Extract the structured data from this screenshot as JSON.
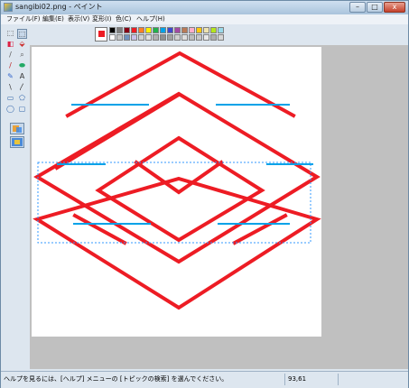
{
  "window": {
    "title": "sangibi02.png - ペイント",
    "minimize": "–",
    "maximize": "□",
    "close": "x"
  },
  "menu": [
    "ファイル(F)",
    "編集(E)",
    "表示(V)",
    "変形(I)",
    "色(C)",
    "ヘルプ(H)"
  ],
  "tools": {
    "free_select": "⬚",
    "rect_select": "⬚",
    "eraser": "◧",
    "fill": "⬙",
    "picker": "/",
    "magnifier": "⌕",
    "pencil": "/",
    "brush": "⬬",
    "airbrush": "✎",
    "text": "A",
    "line": "\\",
    "curve": "〳",
    "rectangle": "▭",
    "polygon": "⬠",
    "ellipse": "◯",
    "rounded_rect": "▢"
  },
  "colors": {
    "foreground": "#ed1c24",
    "background": "#ffffff",
    "palette_row1": [
      "#000000",
      "#7f7f7f",
      "#880015",
      "#ed1c24",
      "#ff7f27",
      "#fff200",
      "#22b14c",
      "#00a2e8",
      "#3f48cc",
      "#a349a4",
      "#b97a57",
      "#ffaec9",
      "#ffc90e",
      "#efe4b0",
      "#b5e61d",
      "#99d9ea"
    ],
    "palette_row2": [
      "#ffffff",
      "#c3c3c3",
      "#7092be",
      "#c8bfe7",
      "#d1d1d1",
      "#e0e0e0",
      "#b0b0b0",
      "#909090",
      "#a0a0a0",
      "#cfcfcf",
      "#dedede",
      "#bcbcbc",
      "#c8c8c8",
      "#e8e8e8",
      "#adadad",
      "#d6d6d6"
    ]
  },
  "status": {
    "help_text": "ヘルプを見るには、[ヘルプ] メニューの [トピックの検索] を選んでください。",
    "coordinates": "93,61"
  }
}
